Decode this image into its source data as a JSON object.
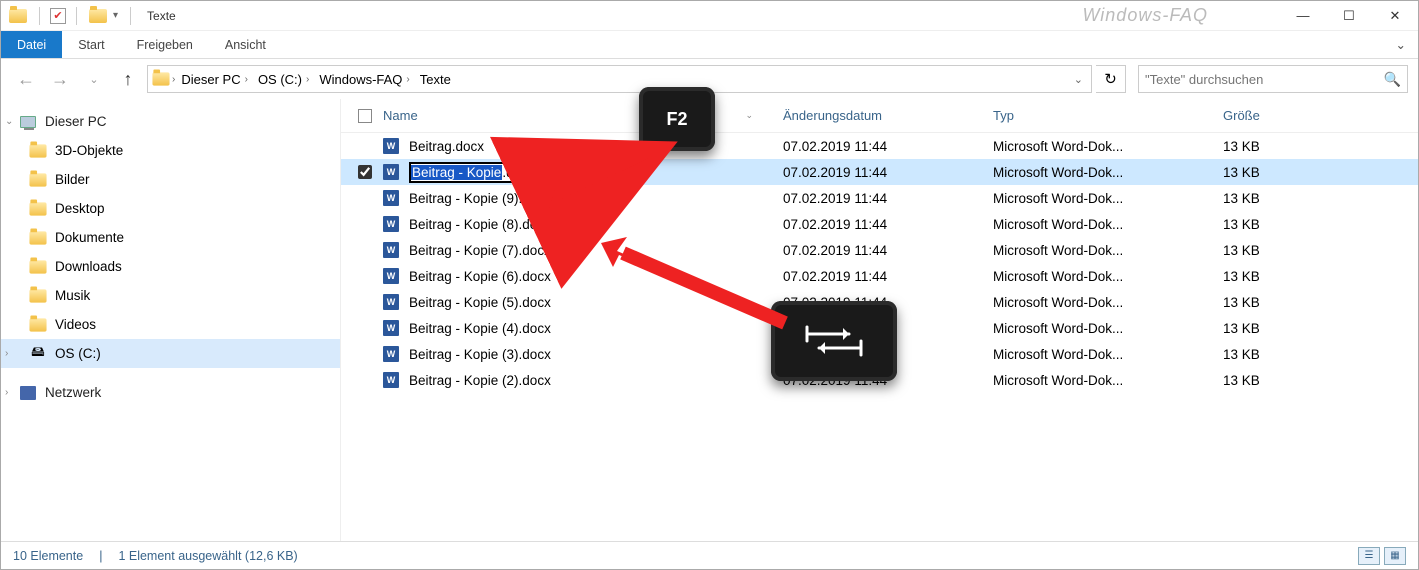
{
  "watermark": "Windows-FAQ",
  "title": "Texte",
  "ribbon": {
    "file": "Datei",
    "tabs": [
      "Start",
      "Freigeben",
      "Ansicht"
    ]
  },
  "breadcrumb": [
    "Dieser PC",
    "OS (C:)",
    "Windows-FAQ",
    "Texte"
  ],
  "search": {
    "placeholder": "\"Texte\" durchsuchen"
  },
  "sidebar": {
    "top": "Dieser PC",
    "items": [
      "3D-Objekte",
      "Bilder",
      "Desktop",
      "Dokumente",
      "Downloads",
      "Musik",
      "Videos"
    ],
    "selected": "OS (C:)",
    "network": "Netzwerk"
  },
  "columns": {
    "name": "Name",
    "date": "Änderungsdatum",
    "type": "Typ",
    "size": "Größe"
  },
  "common": {
    "date": "07.02.2019 11:44",
    "type": "Microsoft Word-Dok...",
    "size": "13 KB"
  },
  "files": [
    {
      "name": "Beitrag.docx"
    },
    {
      "name": "Beitrag - Kopie.docx",
      "selected": true,
      "renaming": true,
      "rename_sel": "Beitrag - Kopie",
      "rename_ext": ".docx"
    },
    {
      "name": "Beitrag - Kopie (9).docx"
    },
    {
      "name": "Beitrag - Kopie (8).docx"
    },
    {
      "name": "Beitrag - Kopie (7).docx"
    },
    {
      "name": "Beitrag - Kopie (6).docx"
    },
    {
      "name": "Beitrag - Kopie (5).docx"
    },
    {
      "name": "Beitrag - Kopie (4).docx"
    },
    {
      "name": "Beitrag - Kopie (3).docx"
    },
    {
      "name": "Beitrag - Kopie (2).docx"
    }
  ],
  "status": {
    "count": "10 Elemente",
    "selection": "1 Element ausgewählt (12,6 KB)"
  },
  "keys": {
    "f2": "F2"
  }
}
